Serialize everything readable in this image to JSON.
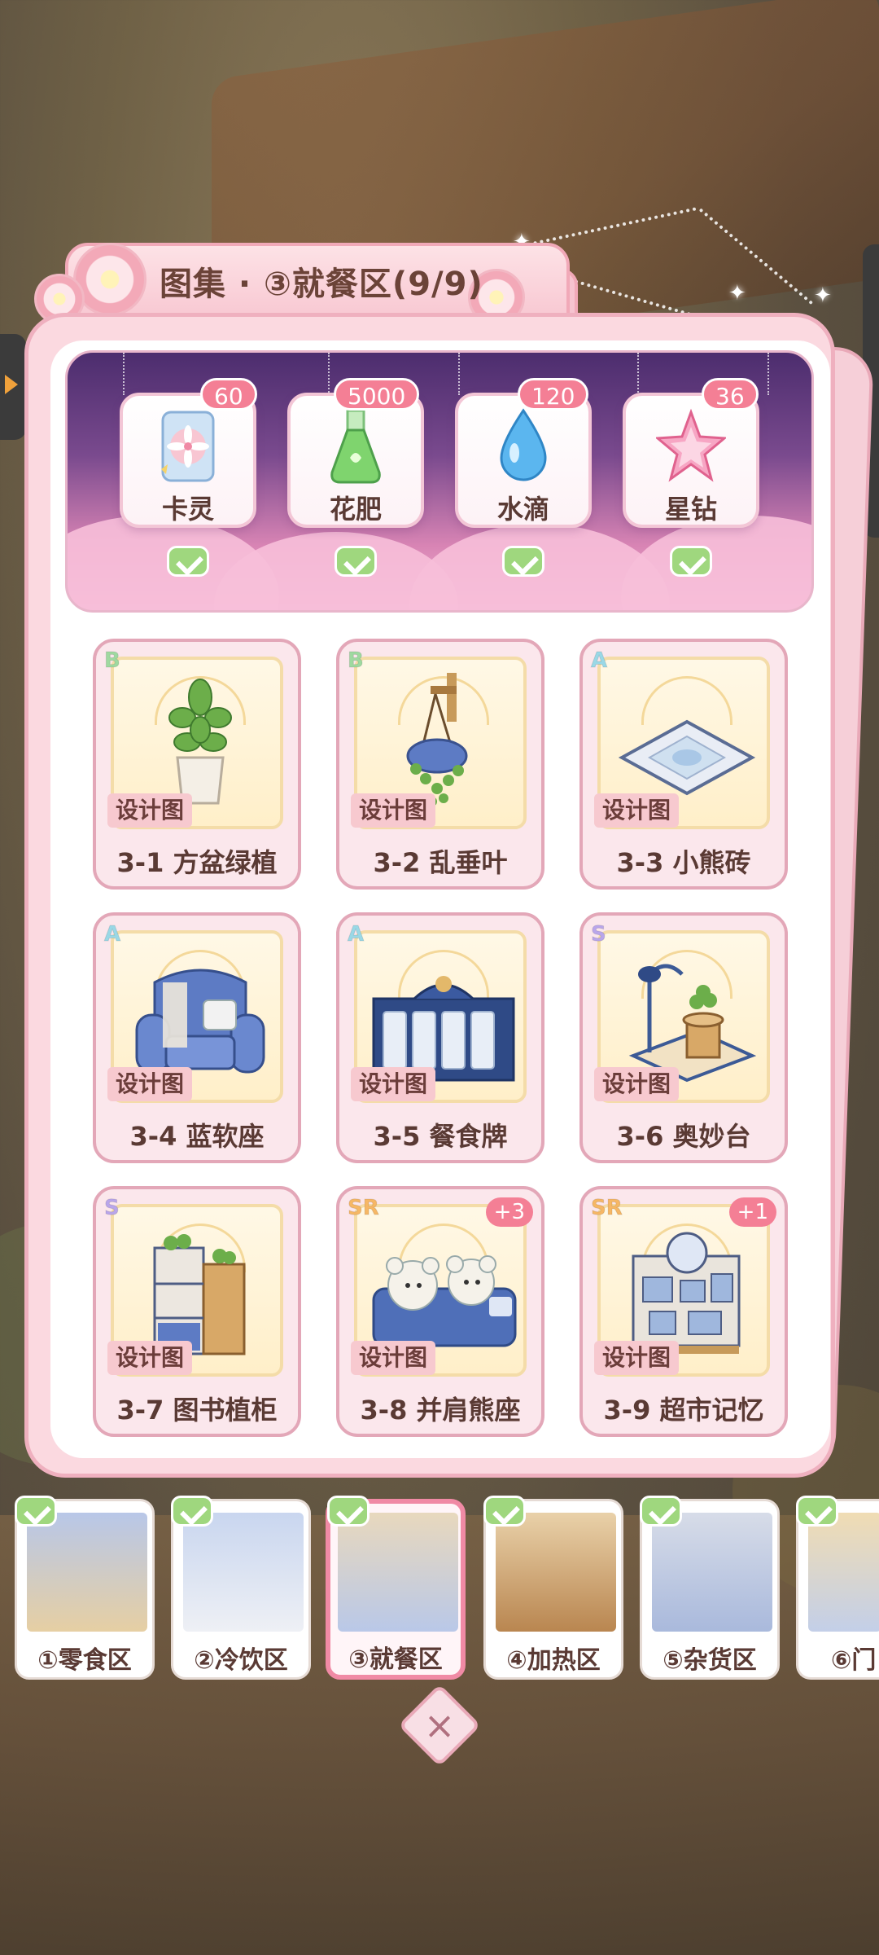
{
  "title": "图集 · ③就餐区(9/9)",
  "rewards": [
    {
      "label": "卡灵",
      "count": "60",
      "icon": "card-spirit-icon",
      "claimed": true
    },
    {
      "label": "花肥",
      "count": "5000",
      "icon": "fertilizer-flask-icon",
      "claimed": true
    },
    {
      "label": "水滴",
      "count": "120",
      "icon": "water-drop-icon",
      "claimed": true
    },
    {
      "label": "星钻",
      "count": "36",
      "icon": "star-diamond-icon",
      "claimed": true
    }
  ],
  "cards": [
    {
      "name": "3-1 方盆绿植",
      "rarity": "B",
      "tag": "设计图",
      "plus": "",
      "icon": "potted-plant-icon"
    },
    {
      "name": "3-2 乱垂叶",
      "rarity": "B",
      "tag": "设计图",
      "plus": "",
      "icon": "hanging-plant-icon"
    },
    {
      "name": "3-3 小熊砖",
      "rarity": "A",
      "tag": "设计图",
      "plus": "",
      "icon": "bear-tile-icon"
    },
    {
      "name": "3-4 蓝软座",
      "rarity": "A",
      "tag": "设计图",
      "plus": "",
      "icon": "blue-armchair-icon"
    },
    {
      "name": "3-5 餐食牌",
      "rarity": "A",
      "tag": "设计图",
      "plus": "",
      "icon": "menu-board-icon"
    },
    {
      "name": "3-6 奥妙台",
      "rarity": "S",
      "tag": "设计图",
      "plus": "",
      "icon": "lamp-table-icon"
    },
    {
      "name": "3-7 图书植柜",
      "rarity": "S",
      "tag": "设计图",
      "plus": "",
      "icon": "bookshelf-icon"
    },
    {
      "name": "3-8 并肩熊座",
      "rarity": "SR",
      "tag": "设计图",
      "plus": "+3",
      "icon": "bear-sofa-icon"
    },
    {
      "name": "3-9 超市记忆",
      "rarity": "SR",
      "tag": "设计图",
      "plus": "+1",
      "icon": "memory-board-icon"
    }
  ],
  "zones": [
    {
      "label": "①零食区",
      "completed": true,
      "active": false
    },
    {
      "label": "②冷饮区",
      "completed": true,
      "active": false
    },
    {
      "label": "③就餐区",
      "completed": true,
      "active": true
    },
    {
      "label": "④加热区",
      "completed": true,
      "active": false
    },
    {
      "label": "⑤杂货区",
      "completed": true,
      "active": false
    },
    {
      "label": "⑥门",
      "completed": true,
      "active": false
    }
  ],
  "close_icon": "close-icon",
  "colors": {
    "accent_pink": "#f47f95",
    "check_green": "#9fd77e",
    "rarity_B": "#9fd9a0",
    "rarity_A": "#9ad8e6",
    "rarity_S": "#b9a6ea",
    "rarity_SR": "#f6b765"
  }
}
